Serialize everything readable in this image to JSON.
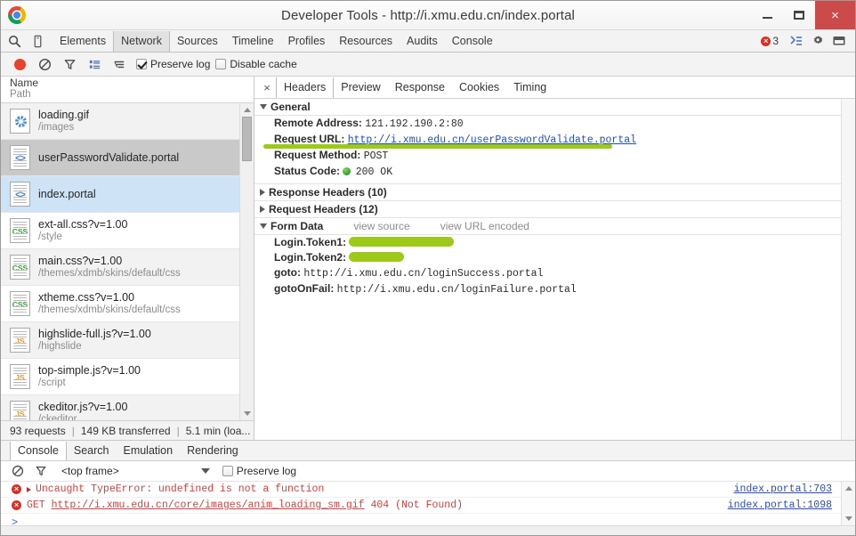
{
  "window": {
    "title": "Developer Tools - http://i.xmu.edu.cn/index.portal",
    "minimize_label": "Minimize",
    "maximize_label": "Maximize",
    "close_label": "×"
  },
  "devtools_tabbar": {
    "inspect_icon": "search-icon",
    "device_icon": "mobile-device-icon",
    "tabs": [
      {
        "label": "Elements",
        "active": false
      },
      {
        "label": "Network",
        "active": true
      },
      {
        "label": "Sources",
        "active": false
      },
      {
        "label": "Timeline",
        "active": false
      },
      {
        "label": "Profiles",
        "active": false
      },
      {
        "label": "Resources",
        "active": false
      },
      {
        "label": "Audits",
        "active": false
      },
      {
        "label": "Console",
        "active": false
      }
    ],
    "error_count": "3",
    "error_badge_glyph": "×",
    "drawer_icon": "show-drawer-icon",
    "settings_icon": "gear-icon",
    "dock_icon": "dock-window-icon",
    "accent_error": "#d93025"
  },
  "network_toolbar": {
    "record_label": "record-button",
    "clear_label": "clear-button",
    "filter_label": "filter-button",
    "view_list_label": "large-rows-button",
    "group_label": "group-by-frame-button",
    "preserve_log": {
      "label": "Preserve log",
      "checked": true
    },
    "disable_cache": {
      "label": "Disable cache",
      "checked": false
    },
    "record_color": "#e8412c"
  },
  "request_list": {
    "header": {
      "name": "Name",
      "path": "Path"
    },
    "rows": [
      {
        "name": "loading.gif",
        "path": "/images",
        "icon": "spinner-image-icon",
        "state": "odd"
      },
      {
        "name": "userPasswordValidate.portal",
        "path": "",
        "icon": "document-code-icon",
        "state": "selected"
      },
      {
        "name": "index.portal",
        "path": "",
        "icon": "document-code-icon",
        "state": "focused"
      },
      {
        "name": "ext-all.css?v=1.00",
        "path": "/style",
        "icon": "document-css-icon",
        "state": "even"
      },
      {
        "name": "main.css?v=1.00",
        "path": "/themes/xdmb/skins/default/css",
        "icon": "document-css-icon",
        "state": "odd"
      },
      {
        "name": "xtheme.css?v=1.00",
        "path": "/themes/xdmb/skins/default/css",
        "icon": "document-css-icon",
        "state": "even"
      },
      {
        "name": "highslide-full.js?v=1.00",
        "path": "/highslide",
        "icon": "document-js-icon",
        "state": "odd"
      },
      {
        "name": "top-simple.js?v=1.00",
        "path": "/script",
        "icon": "document-js-icon",
        "state": "even"
      },
      {
        "name": "ckeditor.js?v=1.00",
        "path": "/ckeditor",
        "icon": "document-js-icon",
        "state": "odd"
      }
    ],
    "status": {
      "requests": "93 requests",
      "sep1": "|",
      "transferred": "149 KB transferred",
      "sep2": "|",
      "time": "5.1 min (loa..."
    }
  },
  "detail": {
    "close_label": "×",
    "tabs": [
      {
        "label": "Headers",
        "active": true
      },
      {
        "label": "Preview",
        "active": false
      },
      {
        "label": "Response",
        "active": false
      },
      {
        "label": "Cookies",
        "active": false
      },
      {
        "label": "Timing",
        "active": false
      }
    ],
    "general": {
      "title": "General",
      "remote_address_key": "Remote Address:",
      "remote_address_value": "121.192.190.2:80",
      "request_url_key": "Request URL:",
      "request_url_value": "http://i.xmu.edu.cn/userPasswordValidate.portal",
      "request_method_key": "Request Method:",
      "request_method_value": "POST",
      "status_code_key": "Status Code:",
      "status_code_value": "200 OK"
    },
    "response_headers_title": "Response Headers (10)",
    "request_headers_title": "Request Headers (12)",
    "form_data": {
      "title": "Form Data",
      "view_source": "view source",
      "view_url_encoded": "view URL encoded",
      "rows": [
        {
          "key": "Login.Token1:",
          "value": "",
          "redacted": "wide"
        },
        {
          "key": "Login.Token2:",
          "value": "",
          "redacted": "narrow"
        },
        {
          "key": "goto:",
          "value": "http://i.xmu.edu.cn/loginSuccess.portal",
          "redacted": ""
        },
        {
          "key": "gotoOnFail:",
          "value": "http://i.xmu.edu.cn/loginFailure.portal",
          "redacted": ""
        }
      ]
    },
    "redaction_color": "#9cc91a"
  },
  "drawer": {
    "tabs": [
      {
        "label": "Console",
        "active": true
      },
      {
        "label": "Search",
        "active": false
      },
      {
        "label": "Emulation",
        "active": false
      },
      {
        "label": "Rendering",
        "active": false
      }
    ],
    "toolbar": {
      "clear_label": "clear-console-button",
      "filter_label": "filter-console-button",
      "frame_selector": "<top frame>",
      "preserve_log": {
        "label": "Preserve log",
        "checked": false
      }
    },
    "messages": [
      {
        "badge": "×",
        "expandable": true,
        "text": "Uncaught TypeError: undefined is not a function",
        "link_text": "",
        "source": "index.portal:703"
      },
      {
        "badge": "×",
        "expandable": false,
        "prefix": "GET ",
        "text": "http://i.xmu.edu.cn/core/images/anim_loading_sm.gif",
        "suffix": " 404 (Not Found)",
        "source": "index.portal:1098"
      }
    ],
    "prompt_glyph": ">"
  }
}
